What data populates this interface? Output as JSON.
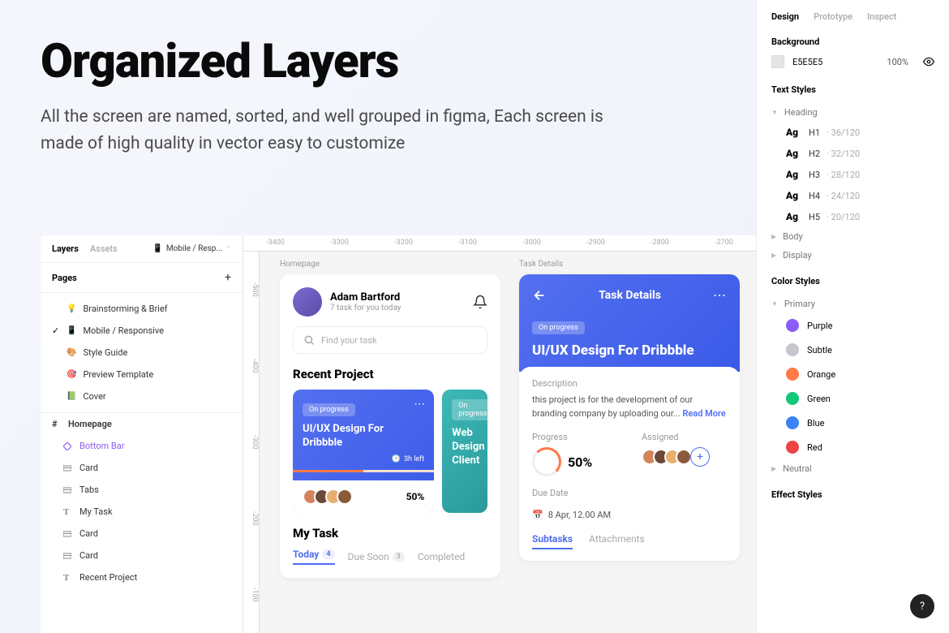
{
  "hero": {
    "title": "Organized Layers",
    "desc": "All the screen are named, sorted, and well grouped in figma, Each screen is made of high quality in vector easy to customize"
  },
  "layersPanel": {
    "tabs": [
      "Layers",
      "Assets"
    ],
    "picker": "Mobile / Resp...",
    "pagesHeader": "Pages",
    "pages": [
      {
        "emoji": "💡",
        "name": "Brainstorming & Brief",
        "checked": false
      },
      {
        "emoji": "📱",
        "name": "Mobile / Responsive",
        "checked": true
      },
      {
        "emoji": "🎨",
        "name": "Style Guide",
        "checked": false
      },
      {
        "emoji": "🎯",
        "name": "Preview Template",
        "checked": false
      },
      {
        "emoji": "📗",
        "name": "Cover",
        "checked": false
      }
    ],
    "tree": {
      "frame": "Homepage",
      "items": [
        {
          "icon": "diamond",
          "name": "Bottom Bar",
          "sel": true
        },
        {
          "icon": "tabs",
          "name": "Card"
        },
        {
          "icon": "tabs",
          "name": "Tabs"
        },
        {
          "icon": "text",
          "name": "My Task"
        },
        {
          "icon": "tabs",
          "name": "Card"
        },
        {
          "icon": "tabs",
          "name": "Card"
        },
        {
          "icon": "text",
          "name": "Recent Project"
        }
      ]
    }
  },
  "ruler": {
    "h": [
      "-3400",
      "-3300",
      "-3200",
      "-3100",
      "-3000",
      "-2900",
      "-2800",
      "-2700"
    ],
    "v": [
      "-500",
      "-400",
      "-300",
      "-200",
      "-100"
    ]
  },
  "homeFrame": {
    "label": "Homepage",
    "user": "Adam Bartford",
    "userSub": "7 task for you today",
    "searchPlaceholder": "Find your task",
    "recent": "Recent Project",
    "card1": {
      "badge": "On progress",
      "title": "UI/UX Design For Dribbble",
      "time": "3h left",
      "pct": "50%"
    },
    "card2": {
      "badge": "On progress",
      "title": "Web Design Client"
    },
    "myTask": "My Task",
    "tabs": [
      {
        "name": "Today",
        "count": "4"
      },
      {
        "name": "Due Soon",
        "count": "3"
      },
      {
        "name": "Completed"
      }
    ]
  },
  "detailFrame": {
    "label": "Task Details",
    "header": "Task Details",
    "badge": "On progress",
    "title": "UI/UX Design For Dribbble",
    "descLabel": "Description",
    "desc": "this project is for the development of our branding company by uploading our... ",
    "readMore": "Read More",
    "progress": "Progress",
    "pct": "50%",
    "assigned": "Assigned",
    "dueLabel": "Due Date",
    "due": "8 Apr, 12.00 AM",
    "tabs": [
      "Subtasks",
      "Attachments"
    ]
  },
  "inspector": {
    "tabs": [
      "Design",
      "Prototype",
      "Inspect"
    ],
    "bgLabel": "Background",
    "bgHex": "E5E5E5",
    "bgOpacity": "100%",
    "tsLabel": "Text Styles",
    "tsGroups": [
      "Heading",
      "Body",
      "Display"
    ],
    "headings": [
      {
        "name": "H1",
        "meta": "36/120"
      },
      {
        "name": "H2",
        "meta": "32/120"
      },
      {
        "name": "H3",
        "meta": "28/120"
      },
      {
        "name": "H4",
        "meta": "24/120"
      },
      {
        "name": "H5",
        "meta": "20/120"
      }
    ],
    "csLabel": "Color Styles",
    "csGroup": "Primary",
    "colors": [
      {
        "name": "Purple",
        "cls": "c-purple"
      },
      {
        "name": "Subtle",
        "cls": "c-subtle"
      },
      {
        "name": "Orange",
        "cls": "c-orange"
      },
      {
        "name": "Green",
        "cls": "c-green"
      },
      {
        "name": "Blue",
        "cls": "c-blue"
      },
      {
        "name": "Red",
        "cls": "c-red"
      }
    ],
    "neutral": "Neutral",
    "esLabel": "Effect Styles"
  },
  "help": "?"
}
